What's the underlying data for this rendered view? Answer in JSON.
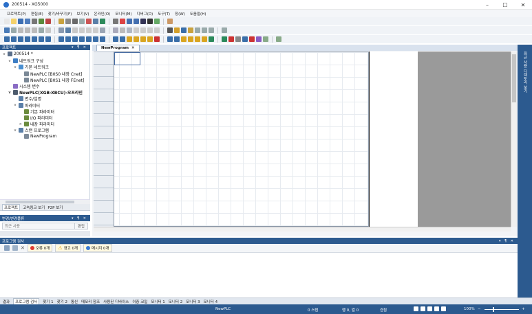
{
  "window": {
    "title": "200514 - XG5000",
    "min": "–",
    "max": "☐",
    "close": "✕"
  },
  "menu": [
    "프로젝트(P)",
    "편집(E)",
    "찾기/바꾸기(F)",
    "보기(V)",
    "온라인(O)",
    "모니터(M)",
    "디버그(D)",
    "도구(T)",
    "창(W)",
    "도움말(H)"
  ],
  "project_panel": {
    "title": "프로젝트",
    "controls": "▾ ¶ ✕",
    "tree": [
      {
        "label": "200514 *",
        "level": 0,
        "expander": "v",
        "icon_color": "#5b6f8a",
        "bold": false
      },
      {
        "label": "네트워크 구성",
        "level": 1,
        "expander": "v",
        "icon_color": "#3c7dc4",
        "bold": false
      },
      {
        "label": "기본 네트워크",
        "level": 2,
        "expander": "v",
        "icon_color": "#4a8fd0",
        "bold": false
      },
      {
        "label": "NewPLC [B0S0 내장 Cnet]",
        "level": 3,
        "expander": "",
        "icon_color": "#7a8896",
        "bold": false
      },
      {
        "label": "NewPLC [B0S1 내장 FEnet]",
        "level": 3,
        "expander": "",
        "icon_color": "#7a8896",
        "bold": false
      },
      {
        "label": "시스템 변수",
        "level": 1,
        "expander": "",
        "icon_color": "#8a6cc4",
        "bold": false
      },
      {
        "label": "NewPLC(XGB-XBCU)-오프라인",
        "level": 1,
        "expander": "v",
        "icon_color": "#4d5b6d",
        "bold": true
      },
      {
        "label": "변수/설명",
        "level": 2,
        "expander": "",
        "icon_color": "#5a7fa8",
        "bold": false
      },
      {
        "label": "파라미터",
        "level": 2,
        "expander": "v",
        "icon_color": "#5a7fa8",
        "bold": false
      },
      {
        "label": "기본 파라미터",
        "level": 3,
        "expander": "",
        "icon_color": "#6b8b3d",
        "bold": false
      },
      {
        "label": "I/O 파라미터",
        "level": 3,
        "expander": "",
        "icon_color": "#6b8b3d",
        "bold": false
      },
      {
        "label": "내장 파라미터",
        "level": 3,
        "expander": ">",
        "icon_color": "#6b8b3d",
        "bold": false
      },
      {
        "label": "스캔 프로그램",
        "level": 2,
        "expander": "v",
        "icon_color": "#5a7fa8",
        "bold": false
      },
      {
        "label": "NewProgram",
        "level": 3,
        "expander": "",
        "icon_color": "#7d8a99",
        "bold": false
      }
    ],
    "tabs": [
      "프로젝트",
      "고속링크 보기",
      "P2P 보기"
    ],
    "active_tab": 0
  },
  "history_panel": {
    "title": "변경/변경플류",
    "controls": "▾ ¶ ✕",
    "select_text": "최근 사용",
    "edit_button": "편집"
  },
  "editor": {
    "tab_label": "NewProgram",
    "tab_close": "✕"
  },
  "right_strip": {
    "label": "최근 사용 디렉토리 보기"
  },
  "check_panel": {
    "title": "프로그램 검사",
    "controls": "▾ ¶ ✕",
    "errors": "오류 0개",
    "warnings": "경고 0개",
    "messages": "메시지 0개",
    "colors": {
      "error": "#e03c31",
      "warning": "#f4b400",
      "message": "#3a7bd5"
    }
  },
  "bottom_tabs": [
    "결과",
    "프로그램 검사",
    "찾기 1",
    "찾기 2",
    "통신",
    "메모리 참조",
    "사용된 디바이스",
    "이중 코일",
    "모니터 1",
    "모니터 2",
    "모니터 3",
    "모니터 4"
  ],
  "bottom_active": 1,
  "status": {
    "plc": "NewPLC",
    "steps": "0 스텝",
    "position": "행 0, 열 0",
    "mode": "겹침",
    "zoom": "100%"
  },
  "colors": {
    "accent": "#2c5a8f",
    "panel_header": "#2c5a8f",
    "gray_zone": "#9a9a9a"
  }
}
